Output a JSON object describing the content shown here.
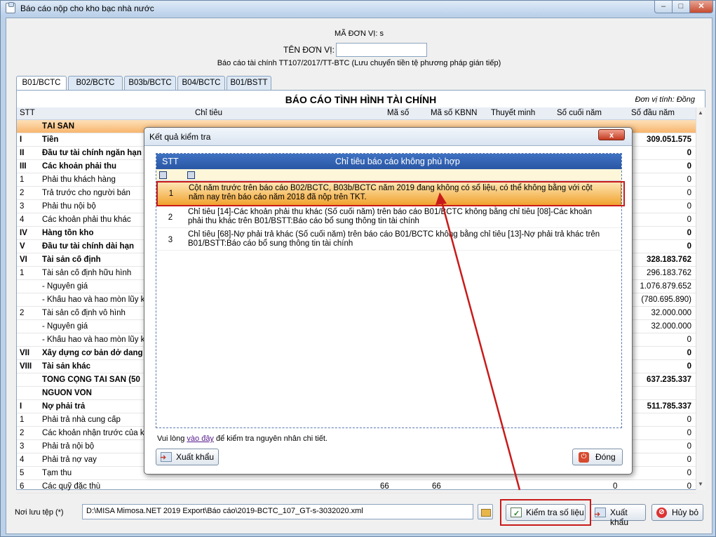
{
  "window": {
    "title": "Báo cáo nộp cho kho bạc nhà nước"
  },
  "header": {
    "unit_code": "MÃ ĐƠN VỊ: s",
    "unit_name_label": "TÊN ĐƠN VỊ:",
    "report_desc": "Báo cáo tài chính TT107/2017/TT-BTC (Lưu chuyển tiền tệ phương pháp gián tiếp)"
  },
  "tabs": [
    "B01/BCTC",
    "B02/BCTC",
    "B03b/BCTC",
    "B04/BCTC",
    "B01/BSTT"
  ],
  "report": {
    "title": "BÁO CÁO TÌNH HÌNH TÀI CHÍNH",
    "unit": "Đơn vị tính: Đồng",
    "columns": {
      "stt": "STT",
      "chi_tieu": "Chỉ tiêu",
      "ma_so": "Mã số",
      "ma_so_kbnn": "Mã số KBNN",
      "thuyet_minh": "Thuyết minh",
      "so_cuoi_nam": "Số cuối năm",
      "so_dau_nam": "Số đầu năm"
    },
    "rows": [
      {
        "stt": "",
        "name": "TÀI SẢN",
        "ms": "",
        "kb": "",
        "v": "",
        "bold": true,
        "section": true
      },
      {
        "stt": "I",
        "name": "Tiền",
        "ms": "",
        "kb": "",
        "v": "309.051.575",
        "bold": true
      },
      {
        "stt": "II",
        "name": "Đầu tư tài chính ngắn hạn",
        "ms": "",
        "kb": "",
        "v": "0",
        "bold": true
      },
      {
        "stt": "III",
        "name": "Các khoản phải thu",
        "ms": "",
        "kb": "",
        "v": "0",
        "bold": true
      },
      {
        "stt": "1",
        "name": "Phải thu khách hàng",
        "ms": "",
        "kb": "",
        "v": "0"
      },
      {
        "stt": "2",
        "name": "Trả trước cho người bán",
        "ms": "",
        "kb": "",
        "v": "0"
      },
      {
        "stt": "3",
        "name": "Phải thu nội bộ",
        "ms": "",
        "kb": "",
        "v": "0"
      },
      {
        "stt": "4",
        "name": "Các khoản phải thu khác",
        "ms": "",
        "kb": "",
        "v": "0"
      },
      {
        "stt": "IV",
        "name": "Hàng tồn kho",
        "ms": "",
        "kb": "",
        "v": "0",
        "bold": true
      },
      {
        "stt": "V",
        "name": "Đầu tư tài chính dài hạn",
        "ms": "",
        "kb": "",
        "v": "0",
        "bold": true
      },
      {
        "stt": "VI",
        "name": "Tài sản cố định",
        "ms": "",
        "kb": "",
        "v": "328.183.762",
        "bold": true
      },
      {
        "stt": "1",
        "name": "Tài sản cố định hữu hình",
        "ms": "",
        "kb": "",
        "v": "296.183.762"
      },
      {
        "stt": "",
        "name": "- Nguyên giá",
        "ms": "",
        "kb": "",
        "v": "1.076.879.652"
      },
      {
        "stt": "",
        "name": "- Khấu hao và hao mòn lũy kế",
        "ms": "",
        "kb": "",
        "v": "(780.695.890)"
      },
      {
        "stt": "2",
        "name": "Tài sản cố định vô hình",
        "ms": "",
        "kb": "",
        "v": "32.000.000"
      },
      {
        "stt": "",
        "name": "- Nguyên giá",
        "ms": "",
        "kb": "",
        "v": "32.000.000"
      },
      {
        "stt": "",
        "name": "- Khấu hao và hao mòn lũy kế",
        "ms": "",
        "kb": "",
        "v": "0"
      },
      {
        "stt": "VII",
        "name": "Xây dựng cơ bản dở dang",
        "ms": "",
        "kb": "",
        "v": "0",
        "bold": true
      },
      {
        "stt": "VIII",
        "name": "Tài sản khác",
        "ms": "",
        "kb": "",
        "v": "0",
        "bold": true
      },
      {
        "stt": "",
        "name": "TỔNG CỘNG TÀI SẢN (50",
        "ms": "",
        "kb": "",
        "v": "637.235.337",
        "bold": true
      },
      {
        "stt": "",
        "name": "NGUỒN VỐN",
        "ms": "",
        "kb": "",
        "v": "",
        "bold": true
      },
      {
        "stt": "I",
        "name": "Nợ phải trả",
        "ms": "",
        "kb": "",
        "v": "511.785.337",
        "bold": true
      },
      {
        "stt": "1",
        "name": "Phải trả nhà cung cấp",
        "ms": "",
        "kb": "",
        "v": "0"
      },
      {
        "stt": "2",
        "name": "Các khoản nhận trước của khá",
        "ms": "",
        "kb": "",
        "v": "0"
      },
      {
        "stt": "3",
        "name": "Phải trả nội bộ",
        "ms": "",
        "kb": "",
        "v": "0"
      },
      {
        "stt": "4",
        "name": "Phải trả nợ vay",
        "ms": "",
        "kb": "",
        "v": "0"
      },
      {
        "stt": "5",
        "name": "Tạm thu",
        "ms": "",
        "kb": "",
        "v": "0"
      },
      {
        "stt": "6",
        "name": "Các quỹ đặc thù",
        "ms": "66",
        "kb": "66",
        "v": "0",
        "mid": "0"
      }
    ]
  },
  "footer": {
    "save_label": "Nơi lưu tệp (*)",
    "save_path": "D:\\MISA Mimosa.NET 2019 Export\\Báo cáo\\2019-BCTC_107_GT-s-3032020.xml",
    "check_btn": "Kiểm tra số liệu",
    "export_btn": "Xuất khẩu",
    "cancel_btn": "Hủy bỏ"
  },
  "dialog": {
    "title": "Kết quả kiểm tra",
    "close_x": "x",
    "col_stt": "STT",
    "col_desc": "Chỉ tiêu báo cáo không phù hợp",
    "rows": [
      {
        "stt": "1",
        "text": "Cột năm trước trên báo cáo B02/BCTC, B03b/BCTC năm 2019 đang không có số liệu, có thể không bằng với cột năm nay trên báo cáo năm 2018 đã nộp trên TKT."
      },
      {
        "stt": "2",
        "text": "Chỉ tiêu [14]-Các khoản phải thu khác (Số cuối năm) trên báo cáo B01/BCTC không bằng chỉ tiêu [08]-Các khoản phải thu khác trên B01/BSTT:Báo cáo bổ sung thông tin tài chính"
      },
      {
        "stt": "3",
        "text": "Chỉ tiêu [68]-Nợ phải trả khác (Số cuối năm) trên báo cáo B01/BCTC không bằng chỉ tiêu [13]-Nợ phải trả khác trên B01/BSTT:Báo cáo bổ sung thông tin tài chính"
      }
    ],
    "note_pre": "Vui lòng ",
    "note_link": "vào đây",
    "note_post": " để kiểm tra nguyên nhân chi tiết.",
    "export_btn": "Xuất khẩu",
    "close_btn": "Đóng"
  },
  "colors": {
    "accent_red": "#c91a1a",
    "grid_header": "#2a57a5",
    "selection": "#f1a22e"
  }
}
